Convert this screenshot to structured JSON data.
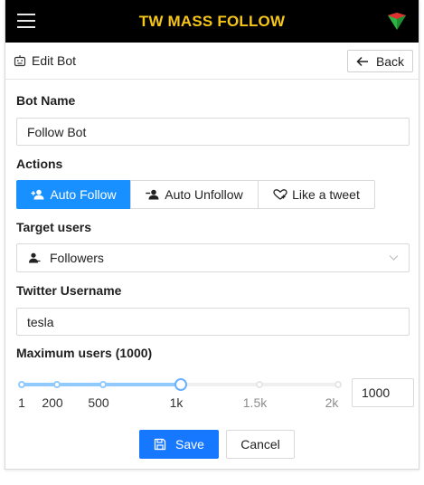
{
  "app": {
    "title": "TW MASS FOLLOW"
  },
  "colors": {
    "topbar": "#000000",
    "title": "#f5c518",
    "primary": "#1677ff",
    "slider": "#91caff"
  },
  "icons": {
    "menu": "hamburger-icon",
    "logo": "logo-icon",
    "page": "robot-icon",
    "back": "arrow-left-icon",
    "save": "save-icon"
  },
  "header": {
    "title": "Edit Bot",
    "back_label": "Back"
  },
  "form": {
    "bot_name": {
      "label": "Bot Name",
      "value": "Follow Bot"
    },
    "actions": {
      "label": "Actions",
      "options": [
        {
          "label": "Auto Follow",
          "icon": "user-add-icon",
          "selected": true
        },
        {
          "label": "Auto Unfollow",
          "icon": "user-remove-icon",
          "selected": false
        },
        {
          "label": "Like a tweet",
          "icon": "heart-icon",
          "selected": false
        }
      ]
    },
    "target": {
      "label": "Target users",
      "value": "Followers"
    },
    "username": {
      "label": "Twitter Username",
      "value": "tesla"
    },
    "max_users": {
      "label": "Maximum users (1000)",
      "value": 1000,
      "input_value": "1000",
      "marks": [
        "1",
        "200",
        "500",
        "1k",
        "1.5k",
        "2k"
      ]
    }
  },
  "buttons": {
    "save": "Save",
    "cancel": "Cancel"
  }
}
